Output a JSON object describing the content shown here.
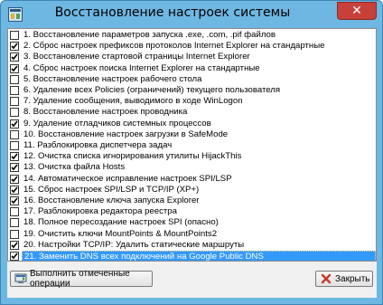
{
  "window": {
    "title": "Восстановление настроек системы",
    "close_glyph": "✕"
  },
  "items": [
    {
      "label": "1. Восстановление параметров запуска .exe, .com, .pif файлов",
      "checked": false,
      "selected": false
    },
    {
      "label": "2. Сброс настроек префиксов протоколов Internet Explorer на стандартные",
      "checked": true,
      "selected": false
    },
    {
      "label": "3. Восстановление стартовой страницы Internet Explorer",
      "checked": true,
      "selected": false
    },
    {
      "label": "4. Сброс настроек поиска Internet Explorer на стандартные",
      "checked": true,
      "selected": false
    },
    {
      "label": "5. Восстановление настроек рабочего стола",
      "checked": false,
      "selected": false
    },
    {
      "label": "6. Удаление всех Policies (ограничений) текущего пользователя",
      "checked": false,
      "selected": false
    },
    {
      "label": "7. Удаление сообщения, выводимого в ходе WinLogon",
      "checked": false,
      "selected": false
    },
    {
      "label": "8. Восстановление настроек проводника",
      "checked": false,
      "selected": false
    },
    {
      "label": "9. Удаление отладчиков системных процессов",
      "checked": true,
      "selected": false
    },
    {
      "label": "10. Восстановление настроек загрузки в SafeMode",
      "checked": false,
      "selected": false
    },
    {
      "label": "11. Разблокировка диспетчера задач",
      "checked": false,
      "selected": false
    },
    {
      "label": "12. Очистка списка игнорирования утилиты HijackThis",
      "checked": true,
      "selected": false
    },
    {
      "label": "13. Очистка файла Hosts",
      "checked": true,
      "selected": false
    },
    {
      "label": "14. Автоматическое исправление настроек SPI/LSP",
      "checked": true,
      "selected": false
    },
    {
      "label": "15. Сброс настроек SPI/LSP и TCP/IP (XP+)",
      "checked": true,
      "selected": false
    },
    {
      "label": "16. Восстановление ключа запуска Explorer",
      "checked": true,
      "selected": false
    },
    {
      "label": "17. Разблокировка редактора реестра",
      "checked": false,
      "selected": false
    },
    {
      "label": "18. Полное пересоздание настроек SPI (опасно)",
      "checked": false,
      "selected": false
    },
    {
      "label": "19. Очистить ключи MountPoints & MountPoints2",
      "checked": false,
      "selected": false
    },
    {
      "label": "20. Настройки TCP/IP: Удалить статические маршруты",
      "checked": true,
      "selected": false
    },
    {
      "label": "21. Заменить DNS всех подключений на Google Public DNS",
      "checked": true,
      "selected": true
    }
  ],
  "buttons": {
    "run_label": "Выполнить отмеченные операции",
    "close_label": "Закрыть"
  },
  "colors": {
    "titlebar": "#6fb7e3",
    "selection": "#3399ff",
    "close": "#c7413a"
  },
  "icons": {
    "app": "app-window-icon",
    "run": "run-operations-icon",
    "close": "close-x-icon"
  }
}
